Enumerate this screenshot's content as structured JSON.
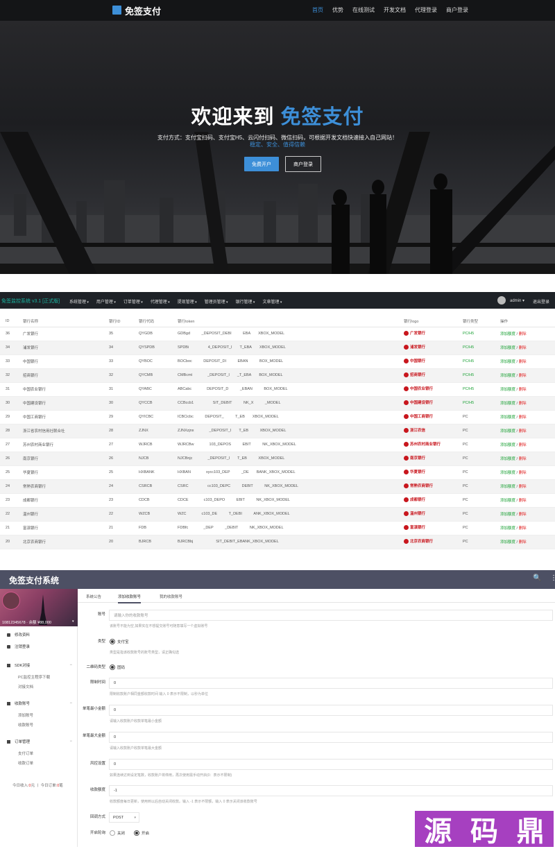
{
  "landing": {
    "brand": "免签支付",
    "nav": [
      "首页",
      "优势",
      "在线测试",
      "开发文档",
      "代理登录",
      "商户登录"
    ],
    "hero_title_a": "欢迎来到",
    "hero_title_b": "免签支付",
    "hero_desc": "支付方式：支付宝扫码、支付宝H5、云闪付扫码、微信扫码，可根据开发文档快速接入自己网站！",
    "hero_desc2": "稳定、安全、值得信赖",
    "btn_register": "免费开户",
    "btn_login": "商户登录",
    "accent": "#3d8fd8"
  },
  "admin": {
    "sys_title": "免签监控系统 v3.1 [正式版]",
    "menu": [
      "系统管理",
      "用户管理",
      "订单管理",
      "代理管理",
      "提现管理",
      "管理员管理",
      "银行管理",
      "文章管理"
    ],
    "user": "admin ▾",
    "logout": "退出登录",
    "headers": [
      "ID",
      "银行名称",
      "银行ID",
      "银行代码",
      "银行token",
      "银行logo",
      "银行类型",
      "操作"
    ],
    "op_add": "添加额度",
    "op_sep": " / ",
    "op_del": "删除",
    "rows": [
      {
        "id": "36",
        "name": "广发银行",
        "bid": "35",
        "code": "QYGDB",
        "token": "GDBgd   _DEPOSIT_DEBI   EBA  XBOX_MODEL",
        "logo": "广发银行",
        "type": "PC/H5"
      },
      {
        "id": "34",
        "name": "浦发银行",
        "bid": "34",
        "code": "QYSPDB",
        "token": "SPDBi     4_DEPOSIT_I  T_EBA  XBOX_MODEL",
        "logo": "浦发银行",
        "type": "PC/H5"
      },
      {
        "id": "33",
        "name": "中国银行",
        "bid": "33",
        "code": "QYBOC",
        "token": "BOCboc   DEPOSIT_DI   EBAN   BOX_MODEL",
        "logo": "中国银行",
        "type": "PC/H5"
      },
      {
        "id": "32",
        "name": "招商银行",
        "bid": "32",
        "code": "QYCMB",
        "token": "CMBcmt    _DEPOSIT_I  _T_EBA  BOX_MODEL",
        "logo": "招商银行",
        "type": "PC/H5"
      },
      {
        "id": "31",
        "name": "中国农业银行",
        "bid": "31",
        "code": "QYABC",
        "token": "ABCabc    DEPOSIT_D   _EBAN   BOX_MODEL",
        "logo": "中国农业银行",
        "type": "PC/H5"
      },
      {
        "id": "30",
        "name": "中国建设银行",
        "bid": "30",
        "code": "QYCCB",
        "token": "CCBccb1     SIT_DEBIT   NK_X   _MODEL",
        "logo": "中国建设银行",
        "type": "PC/H5"
      },
      {
        "id": "29",
        "name": "中国工商银行",
        "bid": "29",
        "code": "QYICBC",
        "token": "ICBCicbc   DEPOSIT_   T_EB  XBOX_MODEL",
        "logo": "中国工商银行",
        "type": "PC"
      },
      {
        "id": "28",
        "name": "浙江省农村信用社联合社",
        "bid": "28",
        "code": "ZJNX",
        "token": "ZJNXzjnx    _DEPOSIT_I  T_EB   XBOX_MODEL",
        "logo": "浙江农信",
        "type": "PC"
      },
      {
        "id": "27",
        "name": "苏州农村商业银行",
        "bid": "27",
        "code": "WJRCB",
        "token": "WJRCBw    103_DEPOS   EBIT   NK_XBOX_MODEL",
        "logo": "苏州农村商业银行",
        "type": "PC"
      },
      {
        "id": "26",
        "name": "南京银行",
        "bid": "26",
        "code": "NJCB",
        "token": "NJCBnjc    _DEPOSIT_I  T_EB   XBOX_MODEL",
        "logo": "南京银行",
        "type": "PC"
      },
      {
        "id": "25",
        "name": "华夏银行",
        "bid": "25",
        "code": "HXBANK",
        "token": "HXBAN    xycc103_DEP   _DE  BANK_XBOX_MODEL",
        "logo": "华夏银行",
        "type": "PC"
      },
      {
        "id": "24",
        "name": "常熟农商银行",
        "bid": "24",
        "code": "CSRCB",
        "token": "CSRC     cc103_DEPC   DEBIT   NK_XBOX_MODEL",
        "logo": "常熟农商银行",
        "type": "PC"
      },
      {
        "id": "23",
        "name": "成都银行",
        "bid": "23",
        "code": "CDCB",
        "token": "CDCE    c103_DEPO   EBIT   NK_XBOX_MODEL",
        "logo": "成都银行",
        "type": "PC"
      },
      {
        "id": "22",
        "name": "温州银行",
        "bid": "22",
        "code": "WZCB",
        "token": "WZC    c103_DE   T_DEBI   ANK_XBOX_MODEL",
        "logo": "温州银行",
        "type": "PC"
      },
      {
        "id": "21",
        "name": "富滇银行",
        "bid": "21",
        "code": "FDB",
        "token": "FDBfc    _DEP   _DEBIT   NK_XBOX_MODEL",
        "logo": "富滇银行",
        "type": "PC"
      },
      {
        "id": "20",
        "name": "北京农商银行",
        "bid": "20",
        "code": "BJRCB",
        "token": "BJRCBbj      SIT_DEBIT_EBANK_XBOX_MODEL",
        "logo": "北京农商银行",
        "type": "PC"
      }
    ]
  },
  "pay": {
    "title": "免签支付系统",
    "search_icon": "🔍",
    "more_icon": "⋮",
    "user_info": "10812345678 · 余额 ¥88,000",
    "sidebar": {
      "profile": "修改资料",
      "logout": "注销登录",
      "sdk": "SDK对接",
      "sdk_sub1": "PC监控主程序下载",
      "sdk_sub2": "对接文档",
      "account": "收款账号",
      "account_sub1": "添加账号",
      "account_sub2": "收款账号",
      "order": "订单管理",
      "order_sub1": "支付订单",
      "order_sub2": "收款订单",
      "footer_a": "今日收入:",
      "footer_amt": "0",
      "footer_b": "元 丨 今日订单:",
      "footer_cnt": "0",
      "footer_c": "笔"
    },
    "tabs": [
      "系统公告",
      "添加收款账号",
      "我的收款账号"
    ],
    "form": {
      "account_label": "账号",
      "account_placeholder": "请输入你的收款账号",
      "account_hint": "该账号不能为空,如果实在不想提交账号可随意填写一个虚拟账号",
      "type_label": "类型",
      "type_option": "支付宝",
      "type_hint": "类型是指该收款账号的账号类型，请正确勾选",
      "qr_label": "二维码类型",
      "qr_option": "固码",
      "limit_time_label": "限制时间",
      "limit_time_value": "0",
      "limit_time_hint": "限制收款账户相同金额收款时间 输入 0 表示不限制，以秒为单位",
      "min_label": "单笔最小金额",
      "min_value": "0",
      "min_hint": "请输入收款账户收款单笔最小金额",
      "max_label": "单笔最大金额",
      "max_value": "0",
      "max_hint": "请输入收款账户收款单笔最大金额",
      "risk_label": "风控设置",
      "risk_value": "0",
      "risk_hint": "如果连续达到设定笔数，收款账户将停用，再次使用需手动开启(0：表示不限制)",
      "quota_label": "收款额度",
      "quota_value": "-1",
      "quota_hint": "收款额度每日更新，使用到以后自动关闭收款。输入 -1 表示不限额，输入 0 表示关闭该收款账号",
      "callback_label": "回调方式",
      "callback_value": "POST",
      "switch_label": "开启轮询",
      "switch_off": "关闭",
      "switch_on": "开启"
    }
  },
  "watermark": [
    "源",
    "码",
    "鼎"
  ]
}
